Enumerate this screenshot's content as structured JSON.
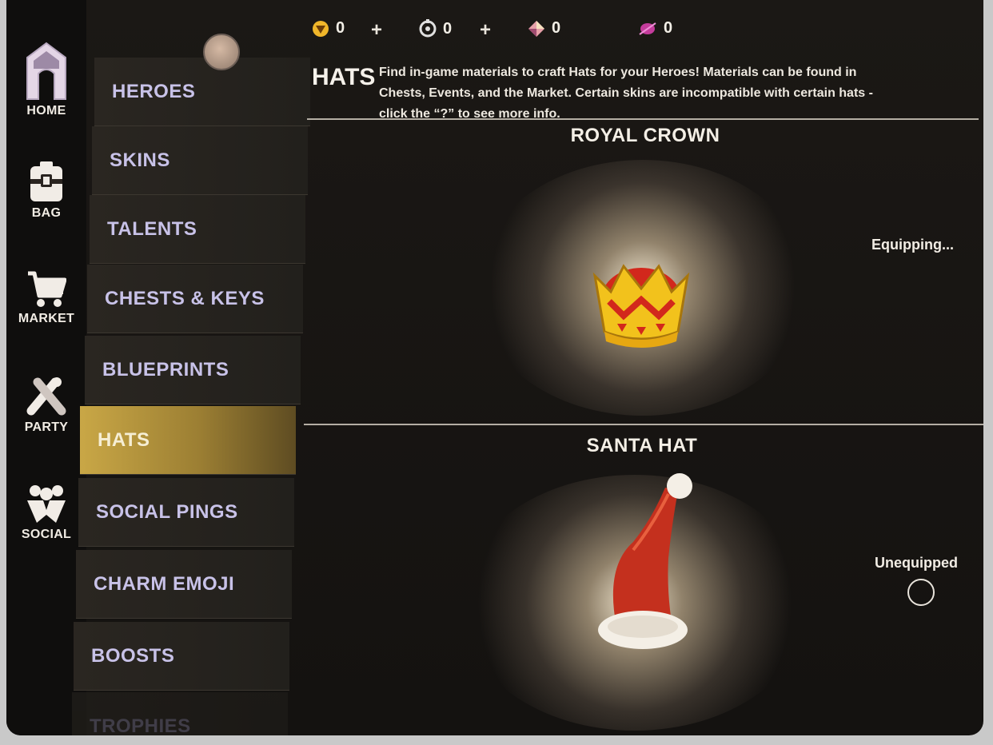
{
  "sidebar": {
    "items": [
      {
        "label": "HOME",
        "icon": "home-icon"
      },
      {
        "label": "BAG",
        "icon": "bag-icon"
      },
      {
        "label": "MARKET",
        "icon": "cart-icon"
      },
      {
        "label": "PARTY",
        "icon": "party-icon"
      },
      {
        "label": "SOCIAL",
        "icon": "social-icon"
      }
    ]
  },
  "menu": {
    "items": [
      {
        "label": "HEROES"
      },
      {
        "label": "SKINS"
      },
      {
        "label": "TALENTS"
      },
      {
        "label": "CHESTS & KEYS"
      },
      {
        "label": "BLUEPRINTS"
      },
      {
        "label": "HATS",
        "active": true
      },
      {
        "label": "SOCIAL PINGS"
      },
      {
        "label": "CHARM EMOJI"
      },
      {
        "label": "BOOSTS"
      },
      {
        "label": "TROPHIES"
      }
    ]
  },
  "currencies": [
    {
      "icon": "gold-token-icon",
      "value": "0",
      "color": "#f0b62a"
    },
    {
      "icon": "silver-token-icon",
      "value": "0",
      "color": "#e0e0e0"
    },
    {
      "icon": "gem-icon",
      "value": "0",
      "color": "#e7a0a8"
    },
    {
      "icon": "essence-icon",
      "value": "0",
      "color": "#c43c9c"
    }
  ],
  "plus_label": "+",
  "header": {
    "title": "HATS",
    "description": "Find in-game materials to craft Hats for your Heroes! Materials can be found in Chests, Events, and the Market. Certain skins are incompatible with certain hats - click the “?” to see more info."
  },
  "hats": [
    {
      "name": "ROYAL CROWN",
      "status": "Equipping...",
      "icon": "crown-icon"
    },
    {
      "name": "SANTA HAT",
      "status": "Unequipped",
      "icon": "santa-hat-icon"
    }
  ],
  "colors": {
    "accent_gold": "#c9a746",
    "menu_text": "#c8c2e8"
  }
}
